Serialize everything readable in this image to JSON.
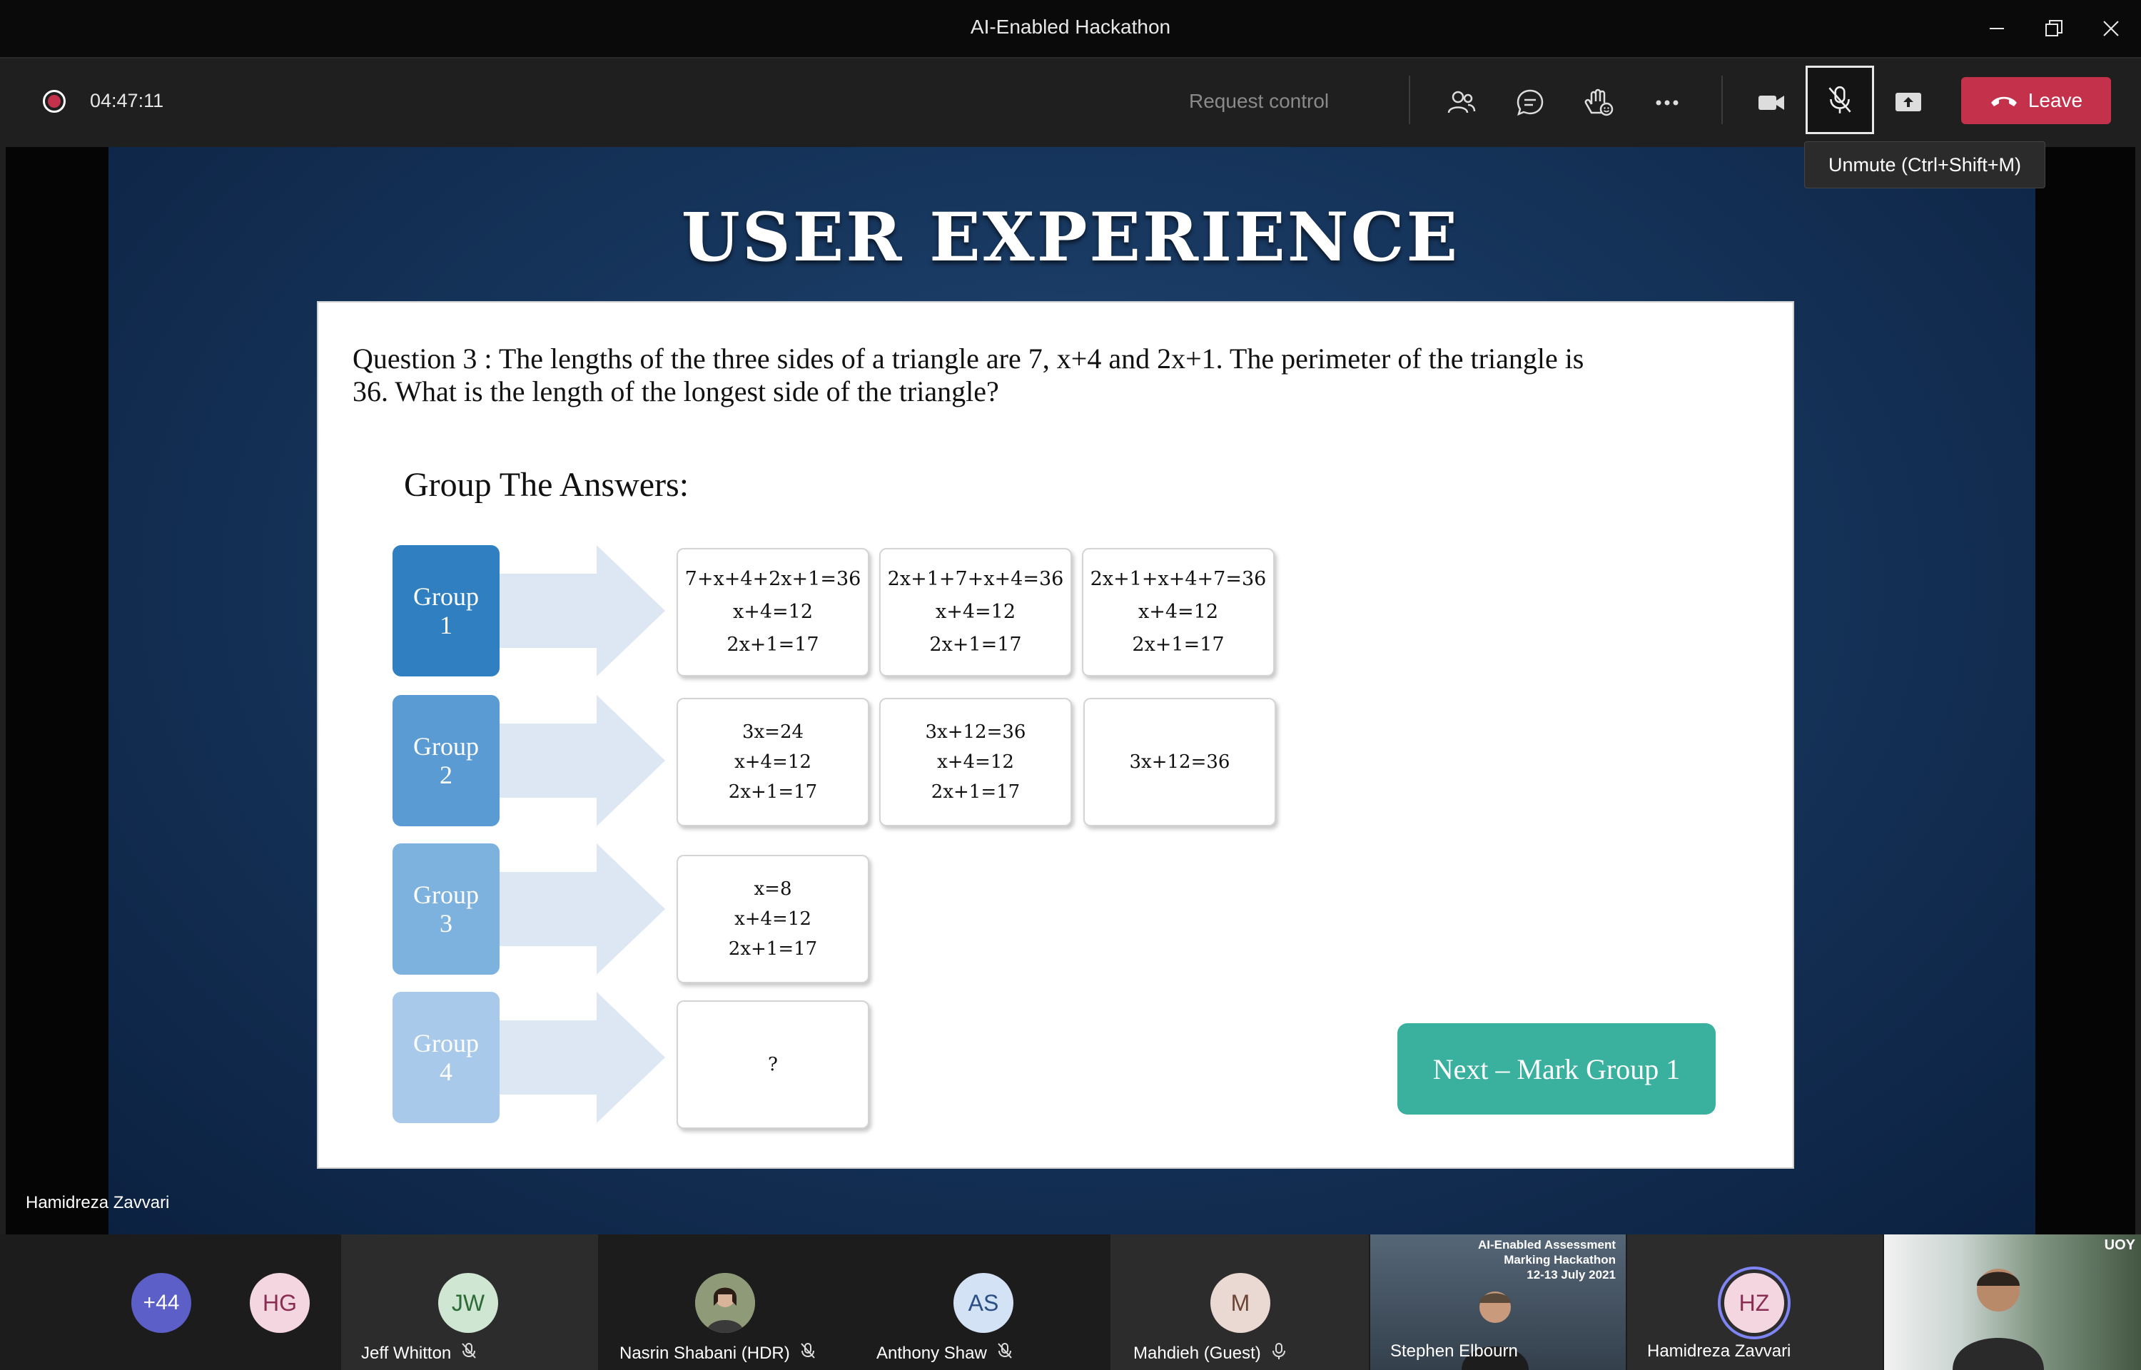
{
  "window": {
    "title": "AI-Enabled Hackathon"
  },
  "toolbar": {
    "timer": "04:47:11",
    "request_control": "Request control",
    "leave_label": "Leave",
    "tooltip": "Unmute (Ctrl+Shift+M)"
  },
  "slide": {
    "title": "USER EXPERIENCE",
    "question_line1": "Question 3 : The lengths of the three sides of a triangle are 7, x+4 and 2x+1.  The perimeter of the triangle is",
    "question_line2": "36.  What is the length of the longest side of the triangle?",
    "group_heading": "Group The Answers:",
    "groups": [
      {
        "word": "Group",
        "num": "1",
        "color": "#2f7fc1"
      },
      {
        "word": "Group",
        "num": "2",
        "color": "#5a9bd3"
      },
      {
        "word": "Group",
        "num": "3",
        "color": "#7db1de"
      },
      {
        "word": "Group",
        "num": "4",
        "color": "#a8c9e9"
      }
    ],
    "answers": {
      "g1a": [
        "7+x+4+2x+1=36",
        "x+4=12",
        "2x+1=17"
      ],
      "g1b": [
        "2x+1+7+x+4=36",
        "x+4=12",
        "2x+1=17"
      ],
      "g1c": [
        "2x+1+x+4+7=36",
        "x+4=12",
        "2x+1=17"
      ],
      "g2a": [
        "3x=24",
        "x+4=12",
        "2x+1=17"
      ],
      "g2b": [
        "3x+12=36",
        "x+4=12",
        "2x+1=17"
      ],
      "g2c": [
        "3x+12=36"
      ],
      "g3a": [
        "x=8",
        "x+4=12",
        "2x+1=17"
      ],
      "g4a": [
        "?"
      ]
    },
    "next_button": "Next – Mark Group 1",
    "presenter": "Hamidreza Zavvari"
  },
  "participants": {
    "overflow": "+44",
    "hg": "HG",
    "jw_initials": "JW",
    "jw_name": "Jeff Whitton",
    "ns_name": "Nasrin Shabani (HDR)",
    "as_initials": "AS",
    "as_name": "Anthony Shaw",
    "m_initials": "M",
    "m_name": "Mahdieh (Guest)",
    "se_name": "Stephen Elbourn",
    "se_banner": [
      "AI-Enabled Assessment",
      "Marking Hackathon",
      "12-13 July 2021"
    ],
    "hz_initials": "HZ",
    "hz_name": "Hamidreza Zavvari",
    "uoy_label": "UOY"
  }
}
